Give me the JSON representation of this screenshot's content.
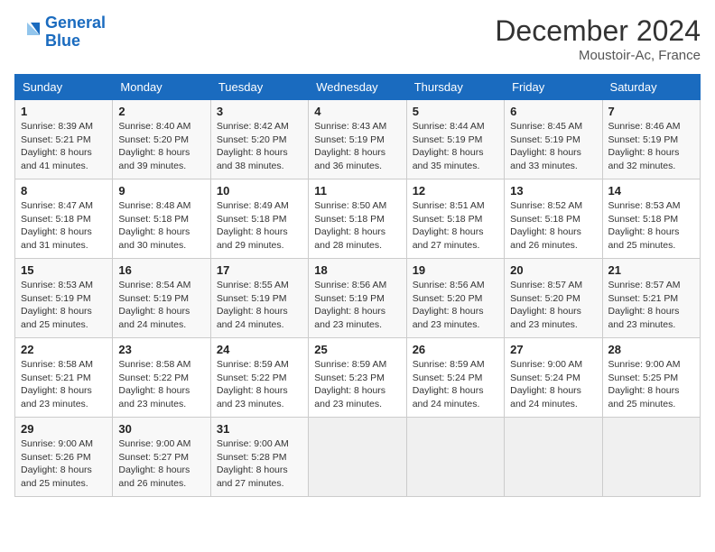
{
  "header": {
    "logo_line1": "General",
    "logo_line2": "Blue",
    "month": "December 2024",
    "location": "Moustoir-Ac, France"
  },
  "days_of_week": [
    "Sunday",
    "Monday",
    "Tuesday",
    "Wednesday",
    "Thursday",
    "Friday",
    "Saturday"
  ],
  "weeks": [
    [
      {
        "day": "1",
        "rise": "8:39 AM",
        "set": "5:21 PM",
        "light": "8 hours and 41 minutes."
      },
      {
        "day": "2",
        "rise": "8:40 AM",
        "set": "5:20 PM",
        "light": "8 hours and 39 minutes."
      },
      {
        "day": "3",
        "rise": "8:42 AM",
        "set": "5:20 PM",
        "light": "8 hours and 38 minutes."
      },
      {
        "day": "4",
        "rise": "8:43 AM",
        "set": "5:19 PM",
        "light": "8 hours and 36 minutes."
      },
      {
        "day": "5",
        "rise": "8:44 AM",
        "set": "5:19 PM",
        "light": "8 hours and 35 minutes."
      },
      {
        "day": "6",
        "rise": "8:45 AM",
        "set": "5:19 PM",
        "light": "8 hours and 33 minutes."
      },
      {
        "day": "7",
        "rise": "8:46 AM",
        "set": "5:19 PM",
        "light": "8 hours and 32 minutes."
      }
    ],
    [
      {
        "day": "8",
        "rise": "8:47 AM",
        "set": "5:18 PM",
        "light": "8 hours and 31 minutes."
      },
      {
        "day": "9",
        "rise": "8:48 AM",
        "set": "5:18 PM",
        "light": "8 hours and 30 minutes."
      },
      {
        "day": "10",
        "rise": "8:49 AM",
        "set": "5:18 PM",
        "light": "8 hours and 29 minutes."
      },
      {
        "day": "11",
        "rise": "8:50 AM",
        "set": "5:18 PM",
        "light": "8 hours and 28 minutes."
      },
      {
        "day": "12",
        "rise": "8:51 AM",
        "set": "5:18 PM",
        "light": "8 hours and 27 minutes."
      },
      {
        "day": "13",
        "rise": "8:52 AM",
        "set": "5:18 PM",
        "light": "8 hours and 26 minutes."
      },
      {
        "day": "14",
        "rise": "8:53 AM",
        "set": "5:18 PM",
        "light": "8 hours and 25 minutes."
      }
    ],
    [
      {
        "day": "15",
        "rise": "8:53 AM",
        "set": "5:19 PM",
        "light": "8 hours and 25 minutes."
      },
      {
        "day": "16",
        "rise": "8:54 AM",
        "set": "5:19 PM",
        "light": "8 hours and 24 minutes."
      },
      {
        "day": "17",
        "rise": "8:55 AM",
        "set": "5:19 PM",
        "light": "8 hours and 24 minutes."
      },
      {
        "day": "18",
        "rise": "8:56 AM",
        "set": "5:19 PM",
        "light": "8 hours and 23 minutes."
      },
      {
        "day": "19",
        "rise": "8:56 AM",
        "set": "5:20 PM",
        "light": "8 hours and 23 minutes."
      },
      {
        "day": "20",
        "rise": "8:57 AM",
        "set": "5:20 PM",
        "light": "8 hours and 23 minutes."
      },
      {
        "day": "21",
        "rise": "8:57 AM",
        "set": "5:21 PM",
        "light": "8 hours and 23 minutes."
      }
    ],
    [
      {
        "day": "22",
        "rise": "8:58 AM",
        "set": "5:21 PM",
        "light": "8 hours and 23 minutes."
      },
      {
        "day": "23",
        "rise": "8:58 AM",
        "set": "5:22 PM",
        "light": "8 hours and 23 minutes."
      },
      {
        "day": "24",
        "rise": "8:59 AM",
        "set": "5:22 PM",
        "light": "8 hours and 23 minutes."
      },
      {
        "day": "25",
        "rise": "8:59 AM",
        "set": "5:23 PM",
        "light": "8 hours and 23 minutes."
      },
      {
        "day": "26",
        "rise": "8:59 AM",
        "set": "5:24 PM",
        "light": "8 hours and 24 minutes."
      },
      {
        "day": "27",
        "rise": "9:00 AM",
        "set": "5:24 PM",
        "light": "8 hours and 24 minutes."
      },
      {
        "day": "28",
        "rise": "9:00 AM",
        "set": "5:25 PM",
        "light": "8 hours and 25 minutes."
      }
    ],
    [
      {
        "day": "29",
        "rise": "9:00 AM",
        "set": "5:26 PM",
        "light": "8 hours and 25 minutes."
      },
      {
        "day": "30",
        "rise": "9:00 AM",
        "set": "5:27 PM",
        "light": "8 hours and 26 minutes."
      },
      {
        "day": "31",
        "rise": "9:00 AM",
        "set": "5:28 PM",
        "light": "8 hours and 27 minutes."
      },
      null,
      null,
      null,
      null
    ]
  ]
}
